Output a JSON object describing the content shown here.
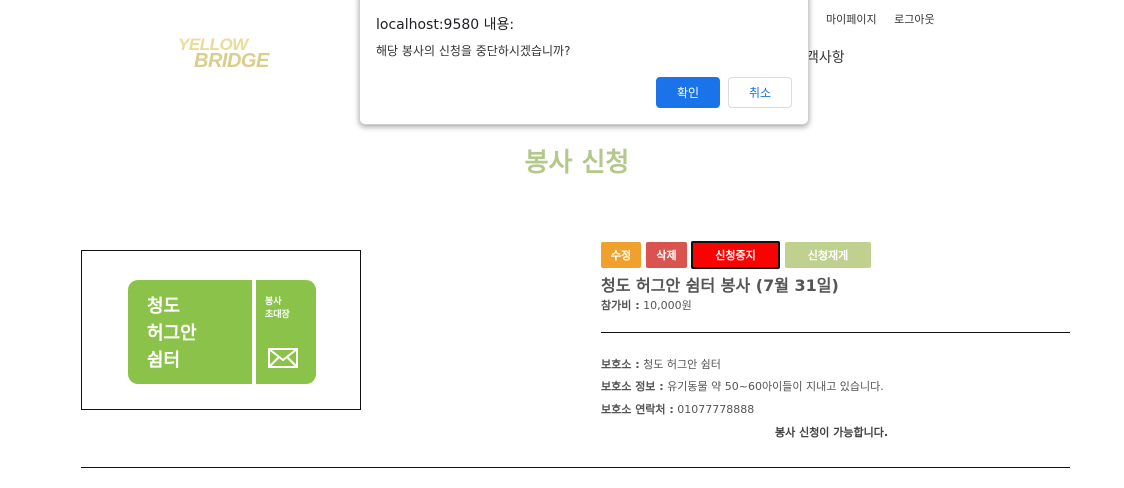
{
  "header": {
    "logo_line1": "YELLOW",
    "logo_line2": "BRIDGE",
    "top_links": [
      "마이페이지",
      "로그아웃"
    ],
    "main_nav_visible": "객사항"
  },
  "page": {
    "title": "봉사 신청"
  },
  "poster": {
    "name_lines": [
      "청도",
      "허그안",
      "쉼터"
    ],
    "side_lines": [
      "봉사",
      "초대장"
    ],
    "icon": "envelope-icon",
    "colors": {
      "ticket": "#8bc34a"
    }
  },
  "actions": {
    "edit": "수정",
    "delete": "삭제",
    "stop": "신청중지",
    "resume": "신청재게"
  },
  "volunteer": {
    "title": "청도 허그안 쉼터 봉사 (7월 31일)",
    "fee_label": "참가비 :",
    "fee_value": "10,000원",
    "shelter_label": "보호소 :",
    "shelter_value": "청도 허그안 쉼터",
    "info_label": "보호소 정보 :",
    "info_value": "유기동물 약 50~60아이들이 지내고 있습니다.",
    "contact_label": "보호소 연락처 :",
    "contact_value": "01077778888",
    "status": "봉사 신청이 가능합니다."
  },
  "dialog": {
    "origin": "localhost:9580 내용:",
    "message": "해당 봉사의 신청을 중단하시겠습니까?",
    "ok": "확인",
    "cancel": "취소"
  },
  "colors": {
    "title": "#b4c88c",
    "edit": "#f0a02c",
    "delete": "#d9534f",
    "stop": "#ff0000",
    "resume": "#bfd08f",
    "dialog_primary": "#1a73e8"
  }
}
